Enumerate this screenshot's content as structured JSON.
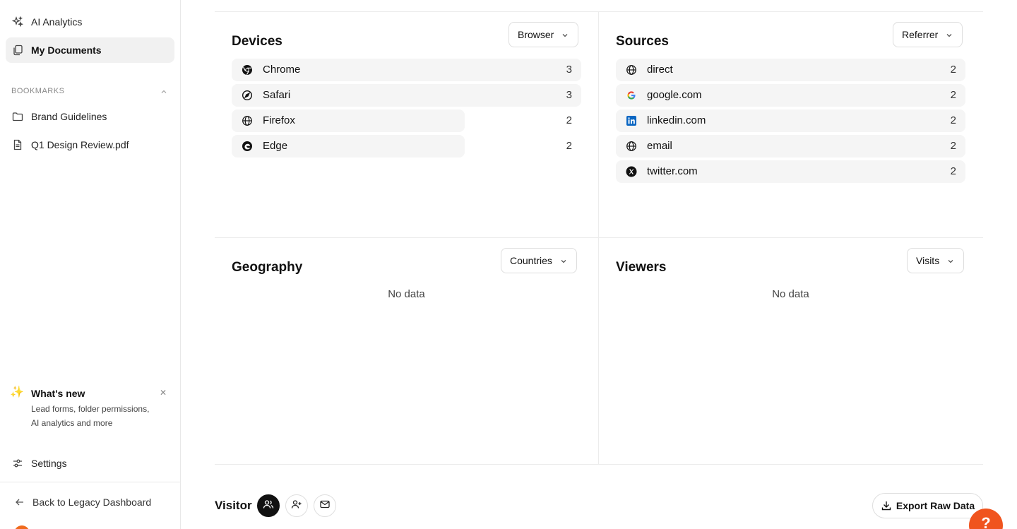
{
  "sidebar": {
    "nav": [
      {
        "label": "AI Analytics",
        "icon": "sparkles-icon",
        "active": false
      },
      {
        "label": "My Documents",
        "icon": "documents-icon",
        "active": true
      }
    ],
    "bookmarks_label": "BOOKMARKS",
    "bookmarks": [
      {
        "label": "Brand Guidelines",
        "icon": "folder-icon"
      },
      {
        "label": "Q1 Design Review.pdf",
        "icon": "file-icon"
      }
    ],
    "whats_new": {
      "title": "What's new",
      "description": "Lead forms, folder permissions, AI analytics and more"
    },
    "settings_label": "Settings",
    "back_label": "Back to Legacy Dashboard"
  },
  "devices": {
    "title": "Devices",
    "dropdown": "Browser",
    "rows": [
      {
        "label": "Chrome",
        "count": "3",
        "icon": "chrome-icon",
        "share": 1.0
      },
      {
        "label": "Safari",
        "count": "3",
        "icon": "safari-icon",
        "share": 1.0
      },
      {
        "label": "Firefox",
        "count": "2",
        "icon": "globe-icon",
        "share": 0.667
      },
      {
        "label": "Edge",
        "count": "2",
        "icon": "edge-icon",
        "share": 0.667
      }
    ]
  },
  "sources": {
    "title": "Sources",
    "dropdown": "Referrer",
    "rows": [
      {
        "label": "direct",
        "count": "2",
        "icon": "globe-icon",
        "share": 1.0
      },
      {
        "label": "google.com",
        "count": "2",
        "icon": "google-icon",
        "share": 1.0
      },
      {
        "label": "linkedin.com",
        "count": "2",
        "icon": "linkedin-icon",
        "share": 1.0
      },
      {
        "label": "email",
        "count": "2",
        "icon": "globe-icon",
        "share": 1.0
      },
      {
        "label": "twitter.com",
        "count": "2",
        "icon": "x-icon",
        "share": 1.0
      }
    ]
  },
  "geography": {
    "title": "Geography",
    "dropdown": "Countries",
    "empty": "No data"
  },
  "viewers": {
    "title": "Viewers",
    "dropdown": "Visits",
    "empty": "No data"
  },
  "visitor": {
    "title": "Visitor",
    "export_label": "Export Raw Data"
  },
  "help": {
    "label": "?"
  },
  "colors": {
    "accent": "#f0541e",
    "row_bg": "#f5f5f5"
  }
}
